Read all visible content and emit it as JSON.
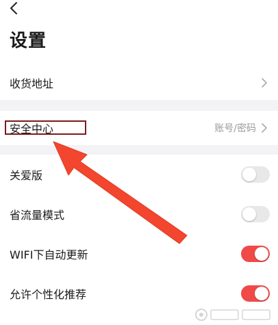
{
  "header": {
    "title": "设置"
  },
  "groups": {
    "address": {
      "label": "收货地址"
    },
    "security": {
      "label": "安全中心",
      "value": "账号/密码"
    },
    "toggles": [
      {
        "label": "关爱版",
        "on": false
      },
      {
        "label": "省流量模式",
        "on": false
      },
      {
        "label": "WIFI下自动更新",
        "on": true
      },
      {
        "label": "允许个性化推荐",
        "on": true
      }
    ]
  },
  "colors": {
    "toggle_on": "#f04a48",
    "arrow": "#f2462f",
    "highlight_border": "#7a1a1a"
  }
}
